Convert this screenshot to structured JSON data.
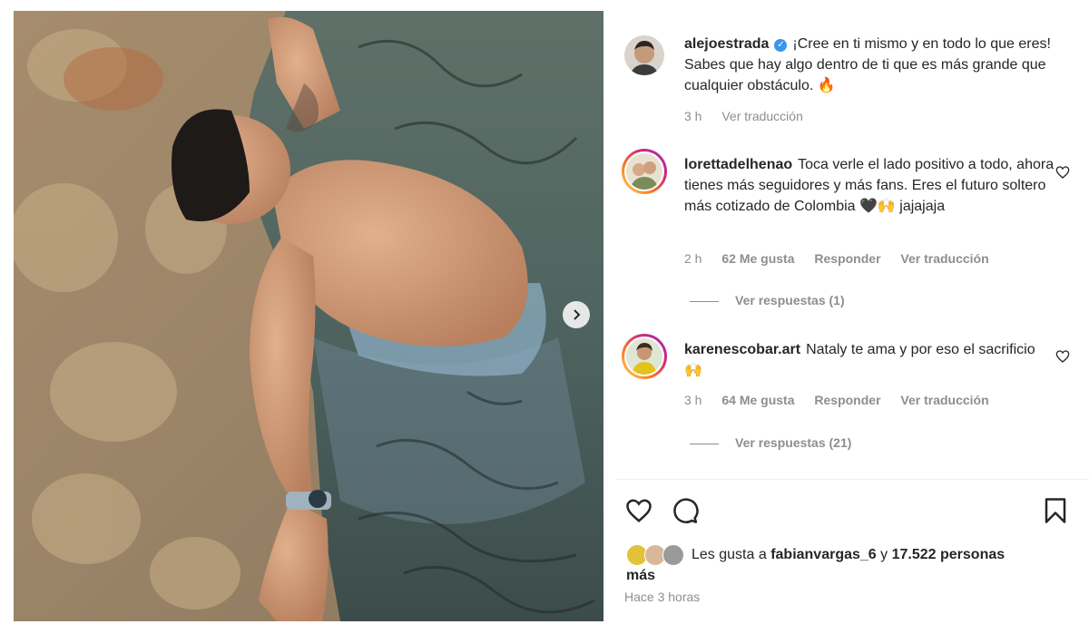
{
  "post": {
    "caption": {
      "username": "alejoestrada",
      "text": "¡Cree en ti mismo y en todo lo que eres! Sabes que hay algo dentro de ti que es más grande que cualquier obstáculo. 🔥",
      "time": "3 h",
      "translate": "Ver traducción"
    },
    "comments": [
      {
        "username": "lorettadelhenao",
        "text": "Toca verle el lado positivo a todo, ahora tienes más seguidores y más fans. Eres el futuro soltero más cotizado de Colombia 🖤🙌 jajajaja",
        "time": "2 h",
        "likes": "62 Me gusta",
        "reply": "Responder",
        "translate": "Ver traducción",
        "view_replies": "Ver respuestas (1)"
      },
      {
        "username": "karenescobar.art",
        "text": "Nataly te ama y por eso el sacrificio 🙌",
        "time": "3 h",
        "likes": "64 Me gusta",
        "reply": "Responder",
        "translate": "Ver traducción",
        "view_replies": "Ver respuestas (21)"
      }
    ],
    "likes": {
      "prefix": "Les gusta a",
      "user": "fabianvargas_6",
      "connector": "y",
      "count": "17.522 personas",
      "suffix": "más"
    },
    "posted": "Hace 3 horas"
  },
  "icons": {
    "like": "heart-icon",
    "comment": "comment-icon",
    "save": "bookmark-icon",
    "next": "chevron-right-icon",
    "verified": "verified-badge-icon"
  },
  "colors": {
    "text": "#262626",
    "muted": "#8e8e8e",
    "verified": "#3897f0"
  }
}
